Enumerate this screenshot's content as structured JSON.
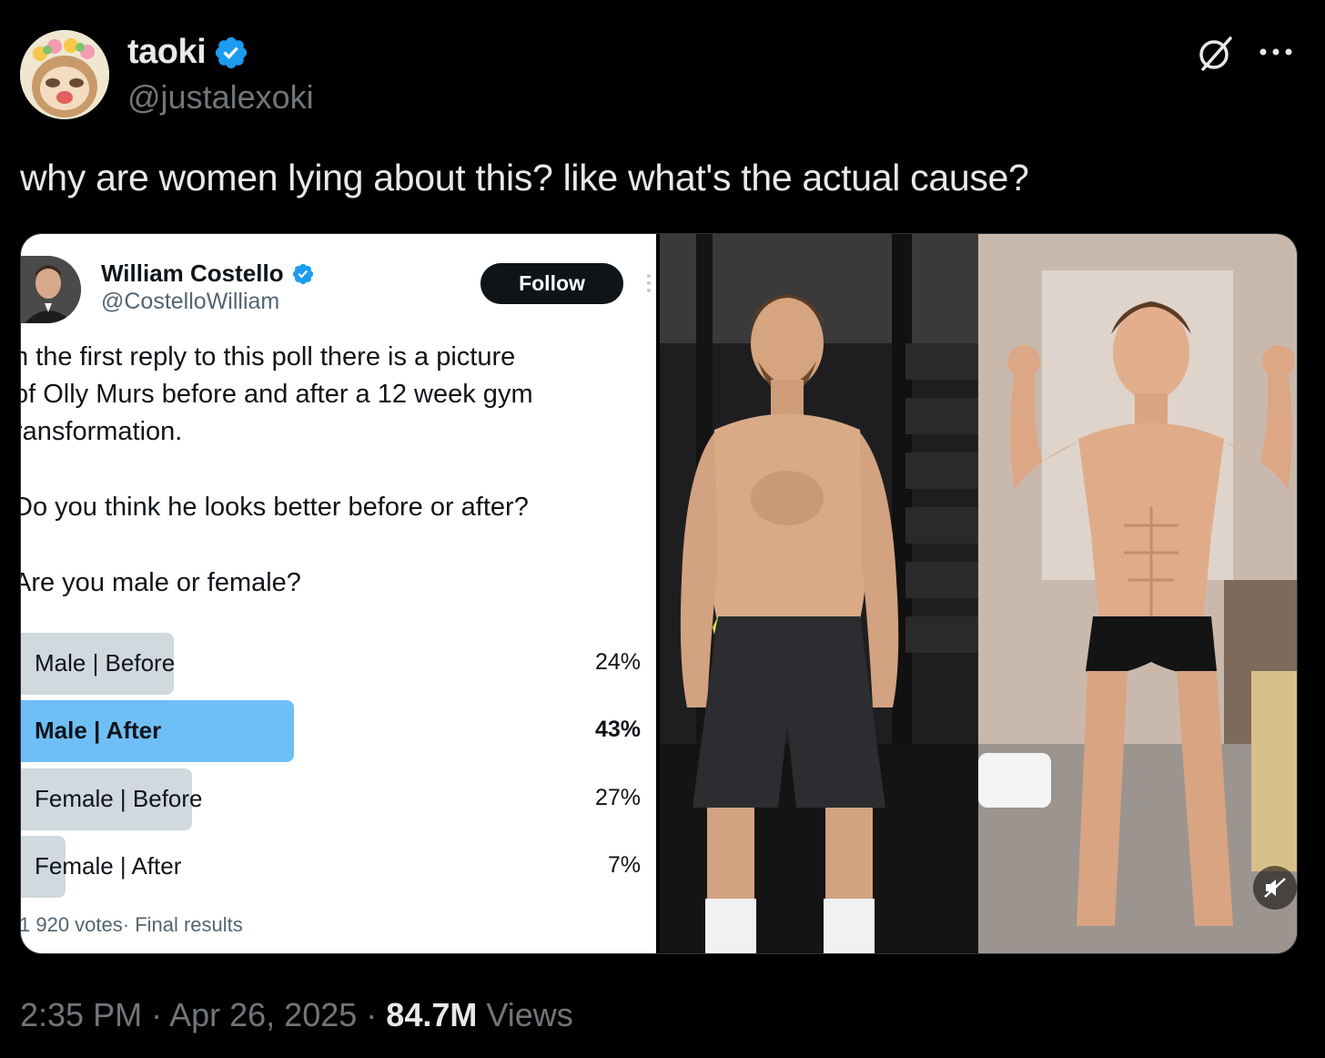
{
  "author": {
    "name": "taoki",
    "handle": "@justalexoki",
    "verified": true,
    "avatar_icon": "sloth-avatar"
  },
  "tweet": {
    "text": "why are women lying about this? like what's the actual cause?"
  },
  "quoted_poll": {
    "author_name": "William Costello",
    "author_handle": "@CostelloWilliam",
    "verified": true,
    "follow_label": "Follow",
    "text_line_1": "n the first reply to this poll there is a picture",
    "text_line_2": "of Olly Murs before and after a 12 week gym",
    "text_line_3": "ransformation.",
    "question_1": "Do you think he looks better before or after?",
    "question_2": "Are you male or female?",
    "options": [
      {
        "label": "Male | Before",
        "percent_label": "24%",
        "percent": 24
      },
      {
        "label": "Male | After",
        "percent_label": "43%",
        "percent": 43,
        "winner": true
      },
      {
        "label": "Female | Before",
        "percent_label": "27%",
        "percent": 27
      },
      {
        "label": "Female | After",
        "percent_label": "7%",
        "percent": 7
      }
    ],
    "footer": "1 920 votes· Final results"
  },
  "media": {
    "before_photo_icon": "shirtless-man-gym-before",
    "after_photo_icon": "shirtless-man-gym-after",
    "mute_icon": "muted-speaker-icon"
  },
  "meta": {
    "time": "2:35 PM",
    "separator": "·",
    "date": "Apr 26, 2025",
    "views_count": "84.7M",
    "views_label": "Views"
  },
  "colors": {
    "background": "#000000",
    "text": "#e7e9ea",
    "muted": "#71767b",
    "verified_blue": "#1d9bf0",
    "poll_winner": "#6fbff7",
    "poll_bar": "#cfd9de"
  }
}
